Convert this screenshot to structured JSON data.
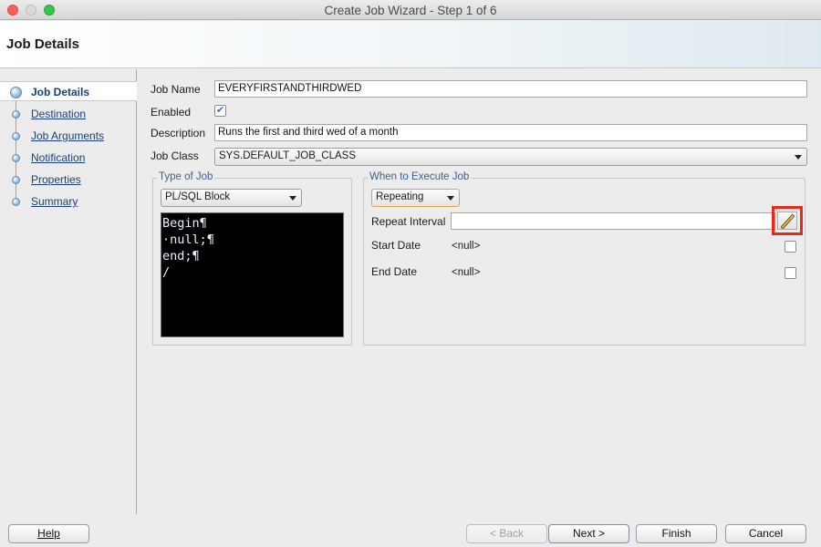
{
  "window": {
    "title": "Create Job Wizard - Step 1 of 6"
  },
  "header": {
    "title": "Job Details"
  },
  "steps": [
    {
      "label": "Job Details",
      "active": true
    },
    {
      "label": "Destination"
    },
    {
      "label": "Job Arguments"
    },
    {
      "label": "Notification"
    },
    {
      "label": "Properties"
    },
    {
      "label": "Summary"
    }
  ],
  "form": {
    "job_name_label": "Job Name",
    "job_name_value": "EVERYFIRSTANDTHIRDWED",
    "enabled_label": "Enabled",
    "enabled_checked": true,
    "description_label": "Description",
    "description_value": "Runs the first and third wed of a month",
    "job_class_label": "Job Class",
    "job_class_value": "SYS.DEFAULT_JOB_CLASS"
  },
  "type_of_job": {
    "legend": "Type of Job",
    "select_value": "PL/SQL Block",
    "code": "Begin¶\n·null;¶\nend;¶\n/"
  },
  "when_to_execute": {
    "legend": "When to Execute Job",
    "select_value": "Repeating",
    "repeat_interval_label": "Repeat Interval",
    "repeat_interval_value": "",
    "start_date_label": "Start Date",
    "start_date_value": "<null>",
    "end_date_label": "End Date",
    "end_date_value": "<null>"
  },
  "footer": {
    "help": "Help",
    "back": "< Back",
    "next": "Next >",
    "finish": "Finish",
    "cancel": "Cancel"
  },
  "colors": {
    "highlight": "#e8281b",
    "link": "#1b3f7a"
  }
}
